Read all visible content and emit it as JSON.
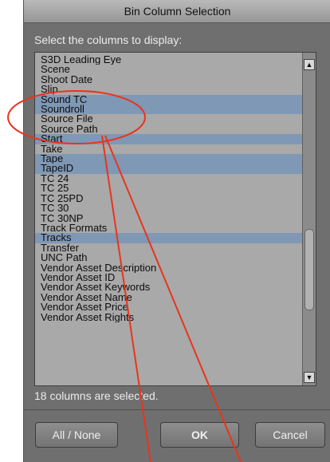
{
  "dialog": {
    "title": "Bin Column Selection",
    "instruction": "Select the columns to display:",
    "status": "18 columns are selected."
  },
  "columns": [
    {
      "label": "S3D Leading Eye",
      "selected": false
    },
    {
      "label": "Scene",
      "selected": false
    },
    {
      "label": "Shoot Date",
      "selected": false
    },
    {
      "label": "Slip",
      "selected": false
    },
    {
      "label": "Sound TC",
      "selected": true
    },
    {
      "label": "Soundroll",
      "selected": true
    },
    {
      "label": "Source File",
      "selected": false
    },
    {
      "label": "Source Path",
      "selected": false
    },
    {
      "label": "Start",
      "selected": true
    },
    {
      "label": "Take",
      "selected": false
    },
    {
      "label": "Tape",
      "selected": true
    },
    {
      "label": "TapeID",
      "selected": true
    },
    {
      "label": "TC 24",
      "selected": false
    },
    {
      "label": "TC 25",
      "selected": false
    },
    {
      "label": "TC 25PD",
      "selected": false
    },
    {
      "label": "TC 30",
      "selected": false
    },
    {
      "label": "TC 30NP",
      "selected": false
    },
    {
      "label": "Track Formats",
      "selected": false
    },
    {
      "label": "Tracks",
      "selected": true
    },
    {
      "label": "Transfer",
      "selected": false
    },
    {
      "label": "UNC Path",
      "selected": false
    },
    {
      "label": "Vendor Asset Description",
      "selected": false
    },
    {
      "label": "Vendor Asset ID",
      "selected": false
    },
    {
      "label": "Vendor Asset Keywords",
      "selected": false
    },
    {
      "label": "Vendor Asset Name",
      "selected": false
    },
    {
      "label": "Vendor Asset Price",
      "selected": false
    },
    {
      "label": "Vendor Asset Rights",
      "selected": false
    }
  ],
  "buttons": {
    "all_none": "All / None",
    "ok": "OK",
    "cancel": "Cancel"
  },
  "scrollbar": {
    "up_icon": "scroll-up-arrow-icon",
    "down_icon": "scroll-down-arrow-icon",
    "position": 0.72
  },
  "colors": {
    "selection": "#7f98b5",
    "annotation": "#e8341c"
  }
}
